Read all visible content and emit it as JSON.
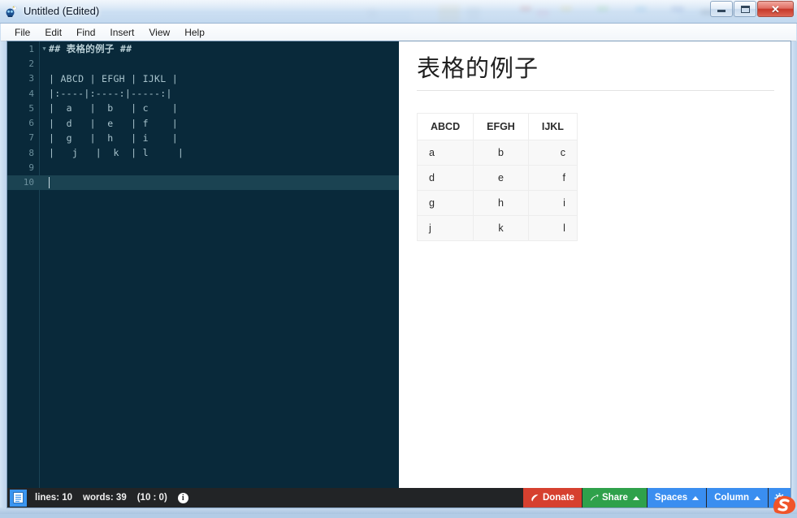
{
  "window": {
    "title": "Untitled (Edited)",
    "app_icon": "app-icon",
    "controls": {
      "minimize": "minimize-button",
      "maximize": "maximize-button",
      "close_glyph": "✕"
    }
  },
  "menubar": {
    "items": [
      {
        "label": "File"
      },
      {
        "label": "Edit"
      },
      {
        "label": "Find"
      },
      {
        "label": "Insert"
      },
      {
        "label": "View"
      },
      {
        "label": "Help"
      }
    ]
  },
  "editor": {
    "theme_bg": "#09293a",
    "current_line_bg": "#1b4352",
    "lines": [
      {
        "num": "1",
        "text": "## 表格的例子 ##",
        "heading": true,
        "fold": "▼",
        "current": false
      },
      {
        "num": "2",
        "text": "",
        "heading": false,
        "fold": "",
        "current": false
      },
      {
        "num": "3",
        "text": "| ABCD | EFGH | IJKL |",
        "heading": false,
        "fold": "",
        "current": false
      },
      {
        "num": "4",
        "text": "|:----|:----:|-----:|",
        "heading": false,
        "fold": "",
        "current": false
      },
      {
        "num": "5",
        "text": "|  a   |  b   | c    |",
        "heading": false,
        "fold": "",
        "current": false
      },
      {
        "num": "6",
        "text": "|  d   |  e   | f    |",
        "heading": false,
        "fold": "",
        "current": false
      },
      {
        "num": "7",
        "text": "|  g   |  h   | i    |",
        "heading": false,
        "fold": "",
        "current": false
      },
      {
        "num": "8",
        "text": "|   j   |  k  | l     |",
        "heading": false,
        "fold": "",
        "current": false
      },
      {
        "num": "9",
        "text": "",
        "heading": false,
        "fold": "",
        "current": false
      },
      {
        "num": "10",
        "text": "",
        "heading": false,
        "fold": "",
        "current": true
      }
    ]
  },
  "preview": {
    "heading": "表格的例子",
    "table": {
      "headers": [
        "ABCD",
        "EFGH",
        "IJKL"
      ],
      "alignments": [
        "left",
        "center",
        "right"
      ],
      "rows": [
        [
          "a",
          "b",
          "c"
        ],
        [
          "d",
          "e",
          "f"
        ],
        [
          "g",
          "h",
          "i"
        ],
        [
          "j",
          "k",
          "l"
        ]
      ]
    }
  },
  "statusbar": {
    "doc_icon": "document-icon",
    "lines_label": "lines: 10",
    "words_label": "words: 39",
    "position_label": "(10 : 0)",
    "info_glyph": "i",
    "buttons": {
      "donate": "Donate",
      "share": "Share",
      "spaces": "Spaces",
      "column": "Column",
      "gear": "gear-icon"
    },
    "colors": {
      "donate": "#d6402f",
      "share": "#2fa14b",
      "spaces": "#3a8ef0",
      "column": "#3a8ef0"
    }
  }
}
